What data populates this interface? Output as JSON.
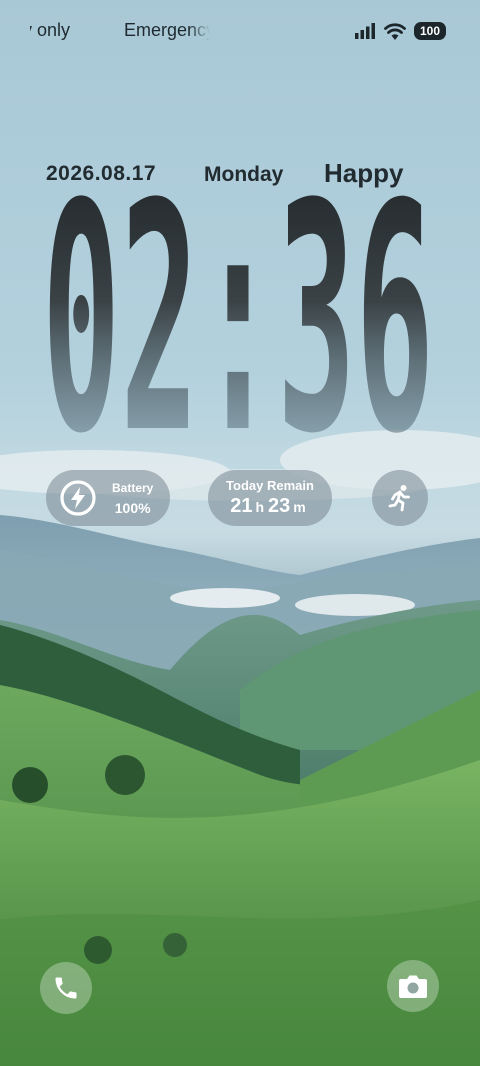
{
  "status_bar": {
    "carrier_1": "Emergency only",
    "carrier_2": "Emergency",
    "battery_level": "100",
    "icons": [
      "signal-icon",
      "wifi-icon",
      "battery-badge"
    ]
  },
  "lockscreen": {
    "date": "2026.08.17",
    "weekday": "Monday",
    "greeting": "Happy",
    "time": "02:36"
  },
  "widgets": {
    "battery": {
      "icon": "bolt-icon",
      "label": "Battery",
      "value": "100%"
    },
    "remain": {
      "title": "Today Remain",
      "hours": "21",
      "hours_unit": "h",
      "minutes": "23",
      "minutes_unit": "m"
    },
    "activity": {
      "icon": "running-icon"
    }
  },
  "shortcuts": {
    "left": {
      "icon": "phone-icon"
    },
    "right": {
      "icon": "camera-icon"
    }
  }
}
